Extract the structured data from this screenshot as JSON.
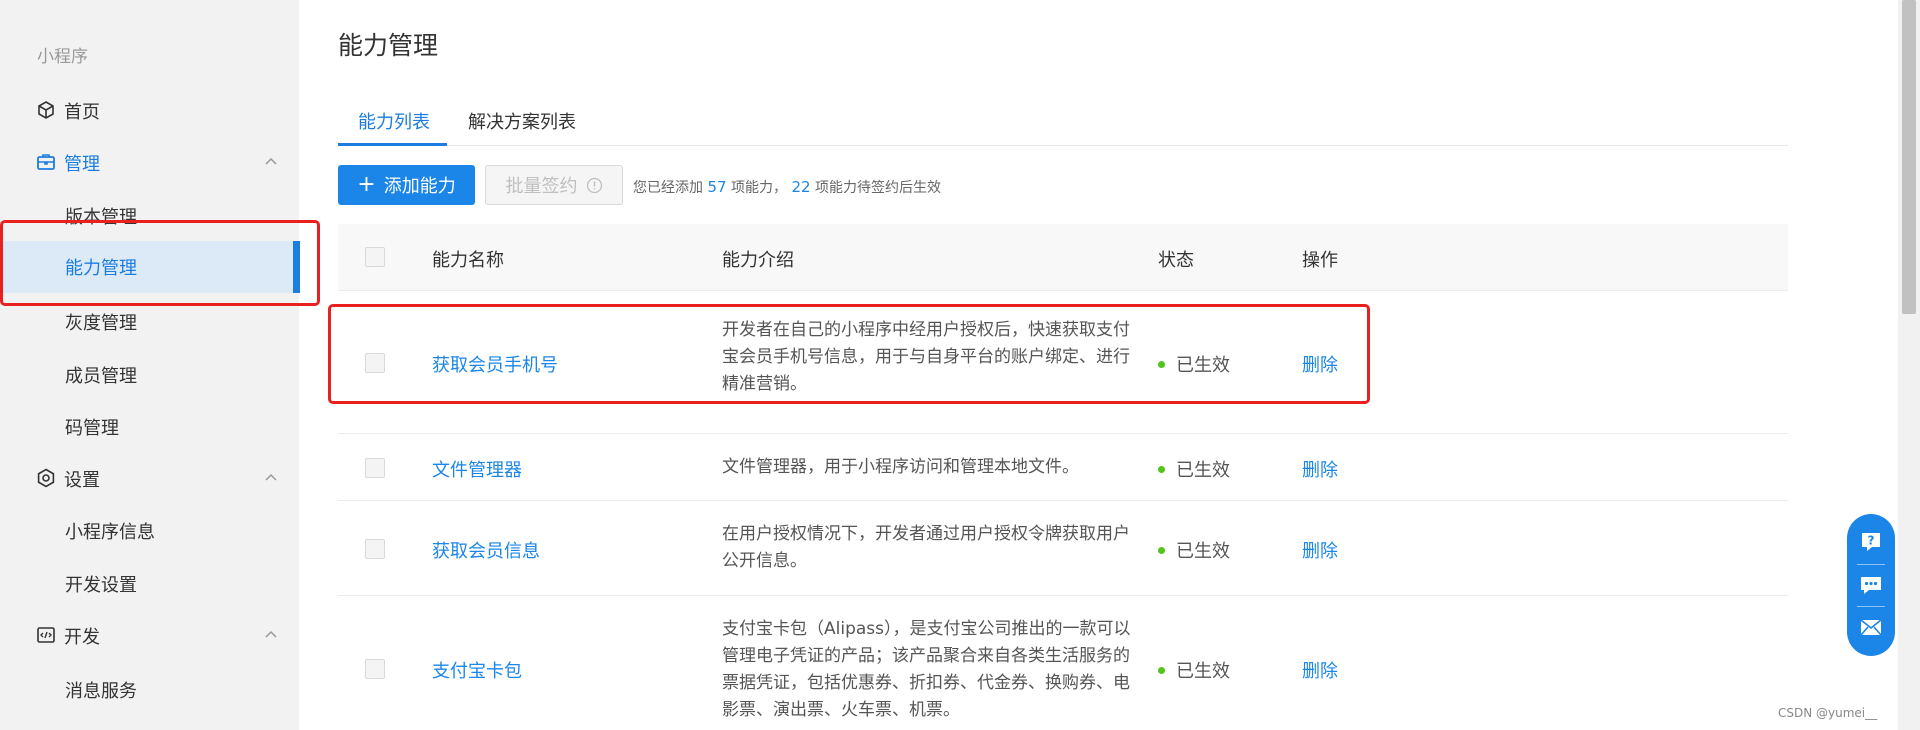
{
  "sidebar": {
    "section_title": "小程序",
    "groups": [
      {
        "label": "首页",
        "icon": "home-cube-icon"
      },
      {
        "label": "管理",
        "icon": "briefcase-icon"
      },
      {
        "label": "设置",
        "icon": "gear-icon"
      },
      {
        "label": "开发",
        "icon": "code-icon"
      }
    ],
    "manage_items": [
      "版本管理",
      "能力管理",
      "灰度管理",
      "成员管理",
      "码管理"
    ],
    "settings_items": [
      "小程序信息",
      "开发设置"
    ],
    "dev_items": [
      "消息服务"
    ]
  },
  "page": {
    "title": "能力管理",
    "tabs": [
      "能力列表",
      "解决方案列表"
    ]
  },
  "toolbar": {
    "add_label": "添加能力",
    "batch_label": "批量签约",
    "summary_prefix": "您已经添加",
    "added_count": "57",
    "summary_middle": "项能力，",
    "pending_count": "22",
    "summary_suffix": "项能力待签约后生效"
  },
  "table": {
    "headers": [
      "能力名称",
      "能力介绍",
      "状态",
      "操作"
    ],
    "rows": [
      {
        "name": "获取会员手机号",
        "desc": "开发者在自己的小程序中经用户授权后，快速获取支付宝会员手机号信息，用于与自身平台的账户绑定、进行精准营销。",
        "status": "已生效",
        "op": "删除"
      },
      {
        "name": "文件管理器",
        "desc": "文件管理器，用于小程序访问和管理本地文件。",
        "status": "已生效",
        "op": "删除"
      },
      {
        "name": "获取会员信息",
        "desc": "在用户授权情况下，开发者通过用户授权令牌获取用户公开信息。",
        "status": "已生效",
        "op": "删除"
      },
      {
        "name": "支付宝卡包",
        "desc": "支付宝卡包（Alipass），是支付宝公司推出的一款可以管理电子凭证的产品；该产品聚合来自各类生活服务的票据凭证，包括优惠券、折扣券、代金券、换购券、电影票、演出票、火车票、机票。",
        "status": "已生效",
        "op": "删除"
      }
    ]
  },
  "colors": {
    "accent": "#1b86e8",
    "success": "#52c41a",
    "highlight": "#e82020"
  },
  "watermark": "CSDN @yumei__"
}
